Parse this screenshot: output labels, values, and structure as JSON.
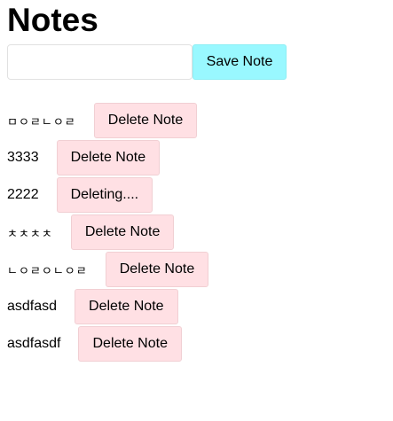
{
  "page": {
    "title": "Notes"
  },
  "form": {
    "input_value": "",
    "input_placeholder": "",
    "save_label": "Save Note"
  },
  "notes": [
    {
      "text": "ㅁㅇㄹㄴㅇㄹ",
      "button_label": "Delete Note",
      "boxy": true
    },
    {
      "text": "3333",
      "button_label": "Delete Note",
      "boxy": false
    },
    {
      "text": "2222",
      "button_label": "Deleting....",
      "boxy": false
    },
    {
      "text": "ㅊㅊㅊㅊ",
      "button_label": "Delete Note",
      "boxy": true
    },
    {
      "text": "ㄴㅇㄹㅇㄴㅇㄹ",
      "button_label": "Delete Note",
      "boxy": true
    },
    {
      "text": "asdfasd",
      "button_label": "Delete Note",
      "boxy": false
    },
    {
      "text": "asdfasdf",
      "button_label": "Delete Note",
      "boxy": false
    }
  ],
  "colors": {
    "save_button_bg": "#99f8ff",
    "delete_button_bg": "#ffe0e4"
  }
}
